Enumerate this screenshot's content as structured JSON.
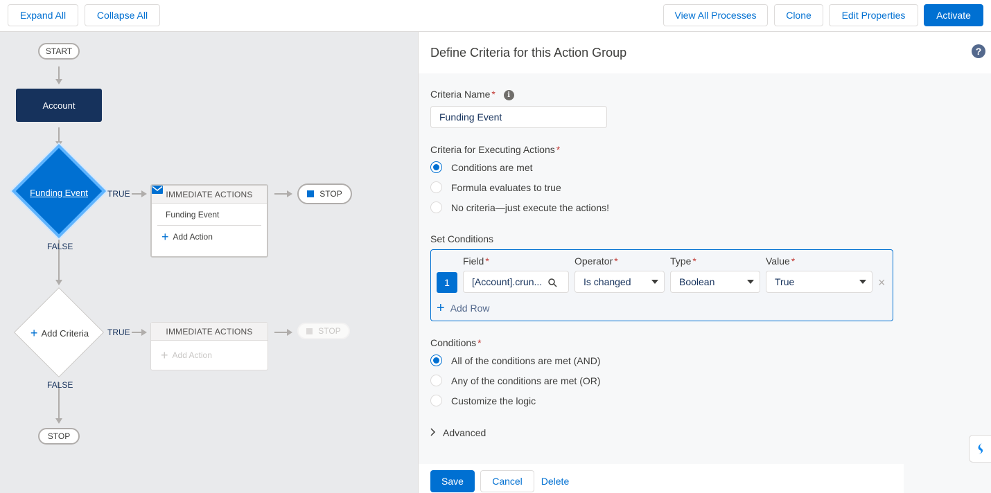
{
  "toolbar": {
    "expand_all": "Expand All",
    "collapse_all": "Collapse All",
    "view_all_processes": "View All Processes",
    "clone": "Clone",
    "edit_properties": "Edit Properties",
    "activate": "Activate"
  },
  "canvas": {
    "start_label": "START",
    "object_label": "Account",
    "criteria1": {
      "label": "Funding Event",
      "true_label": "TRUE",
      "false_label": "FALSE",
      "actions_header": "IMMEDIATE ACTIONS",
      "action_item": "Funding Event",
      "add_action": "Add Action",
      "stop_label": "STOP"
    },
    "criteria2": {
      "label": "Add Criteria",
      "true_label": "TRUE",
      "false_label": "FALSE",
      "actions_header": "IMMEDIATE ACTIONS",
      "add_action": "Add Action",
      "stop_label": "STOP"
    },
    "end_stop_label": "STOP"
  },
  "panel": {
    "title": "Define Criteria for this Action Group",
    "criteria_name_label": "Criteria Name",
    "criteria_name_value": "Funding Event",
    "executing_label": "Criteria for Executing Actions",
    "executing_options": [
      "Conditions are met",
      "Formula evaluates to true",
      "No criteria—just execute the actions!"
    ],
    "set_conditions_label": "Set Conditions",
    "columns": {
      "field": "Field",
      "operator": "Operator",
      "type": "Type",
      "value": "Value"
    },
    "row": {
      "number": "1",
      "field": "[Account].crun...",
      "operator": "Is changed",
      "type": "Boolean",
      "value": "True"
    },
    "add_row": "Add Row",
    "conditions_label": "Conditions",
    "conditions_options": [
      "All of the conditions are met (AND)",
      "Any of the conditions are met (OR)",
      "Customize the logic"
    ],
    "advanced": "Advanced",
    "save": "Save",
    "cancel": "Cancel",
    "delete": "Delete"
  },
  "colors": {
    "brand": "#0070d2",
    "navy": "#16325c",
    "canvas_bg": "#e9eaec"
  }
}
